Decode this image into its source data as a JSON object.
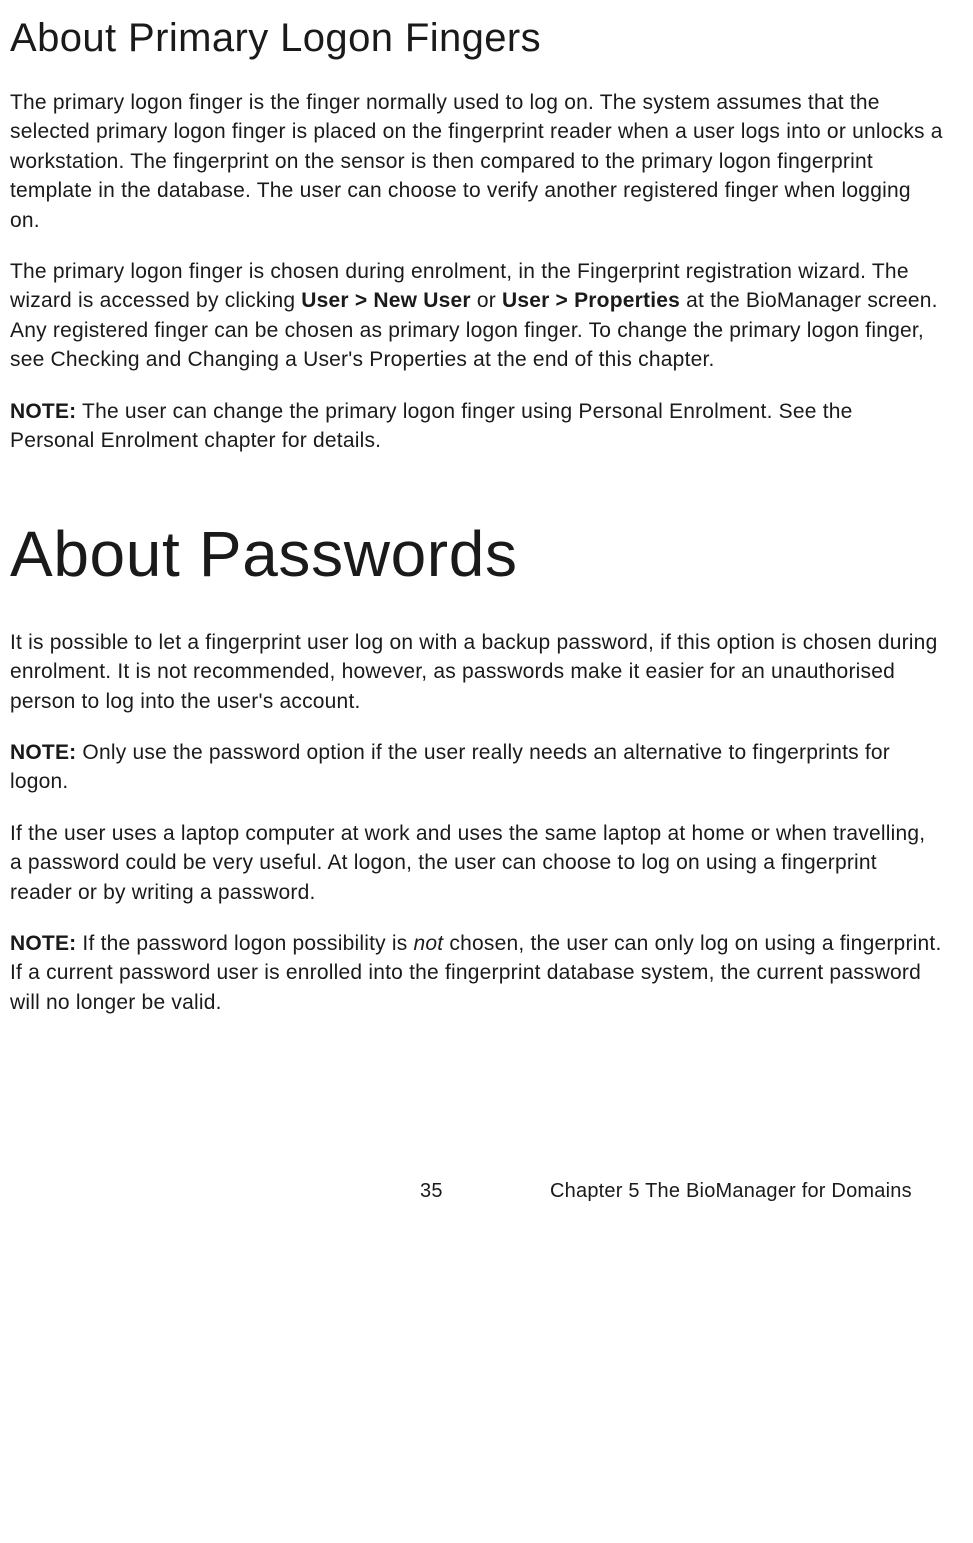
{
  "section1": {
    "heading": "About Primary Logon Fingers",
    "p1": "The primary logon finger is the finger normally used to log on. The system assumes that the selected primary logon finger is placed on the fingerprint reader when a user logs into or unlocks a workstation. The fingerprint on the sensor is then compared to the primary logon fingerprint template in the database. The user can choose to verify another registered finger when logging on.",
    "p2_pre": "The primary logon finger is chosen during enrolment, in the Fingerprint registration wizard. The wizard is accessed by clicking ",
    "p2_bold1": "User > New User",
    "p2_mid": " or ",
    "p2_bold2": "User > Properties",
    "p2_post": " at the BioManager screen. Any registered finger can be chosen as primary logon finger. To change the primary logon finger, see Checking and Changing a User's Properties at the end of this chapter.",
    "p3_label": "NOTE:",
    "p3_text": " The user can change the primary logon finger using Personal Enrolment. See the Personal Enrolment chapter for details."
  },
  "section2": {
    "heading": "About Passwords",
    "p1": "It is possible to let a fingerprint user log on with a backup password, if this option is chosen during enrolment. It is not recommended, however, as passwords make it easier for an unauthorised person to log into the user's account.",
    "p2_label": "NOTE:",
    "p2_text": " Only use the password option if the user really needs an alternative to fingerprints for logon.",
    "p3": "If the user uses a laptop computer at work and uses the same laptop at home or when travelling, a password could be very useful. At logon, the user can choose to log on using a fingerprint reader or by writing a password.",
    "p4_label": "NOTE:",
    "p4_pre": " If the password logon possibility is ",
    "p4_italic": "not",
    "p4_post": " chosen, the user can only log on using a fingerprint. If a current password user is enrolled into the fingerprint database system, the current password will no longer be valid."
  },
  "footer": {
    "page_number": "35",
    "chapter": "Chapter 5 The BioManager for Domains"
  }
}
